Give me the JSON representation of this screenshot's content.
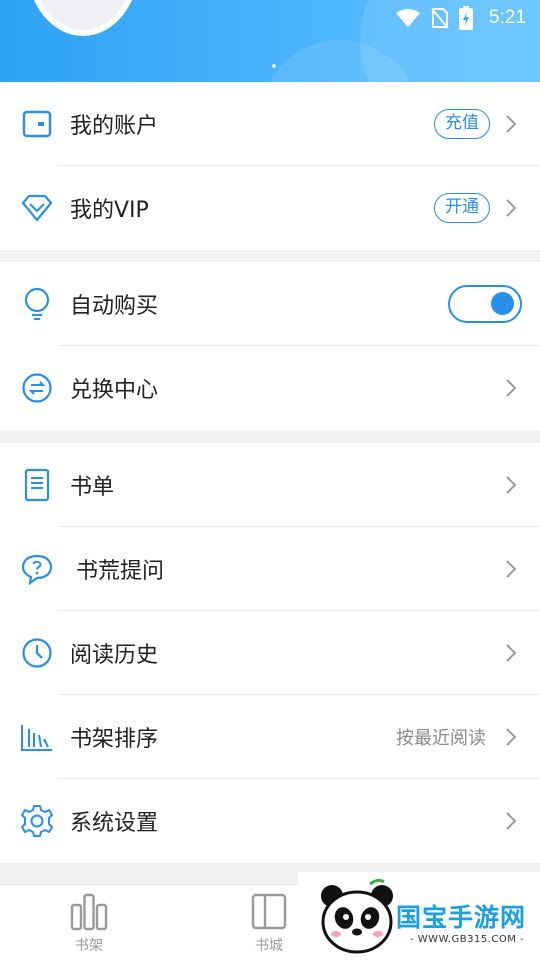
{
  "status_bar": {
    "time": "5:21",
    "icons": [
      "wifi-icon",
      "no-sim-icon",
      "battery-charging-icon"
    ]
  },
  "accent_color": "#2a8fe8",
  "groups": [
    {
      "items": [
        {
          "label": "我的账户",
          "icon": "wallet-icon",
          "action_pill": "充值"
        },
        {
          "label": "我的VIP",
          "icon": "diamond-icon",
          "action_pill": "开通"
        }
      ]
    },
    {
      "items": [
        {
          "label": "自动购买",
          "icon": "lightbulb-icon",
          "toggle_on": true
        },
        {
          "label": "兑换中心",
          "icon": "exchange-icon"
        }
      ]
    },
    {
      "items": [
        {
          "label": "书单",
          "icon": "booklist-icon"
        },
        {
          "label": "书荒提问",
          "icon": "question-bubble-icon"
        },
        {
          "label": "阅读历史",
          "icon": "clock-icon"
        },
        {
          "label": "书架排序",
          "icon": "sort-bars-icon",
          "hint": "按最近阅读"
        },
        {
          "label": "系统设置",
          "icon": "gear-icon"
        }
      ]
    }
  ],
  "tab_bar": [
    {
      "label": "书架",
      "icon": "bookshelf-icon"
    },
    {
      "label": "书城",
      "icon": "bookstore-icon"
    }
  ],
  "watermark": {
    "title": "国宝手游网",
    "subtitle": "- WWW.GB315.COM -"
  }
}
